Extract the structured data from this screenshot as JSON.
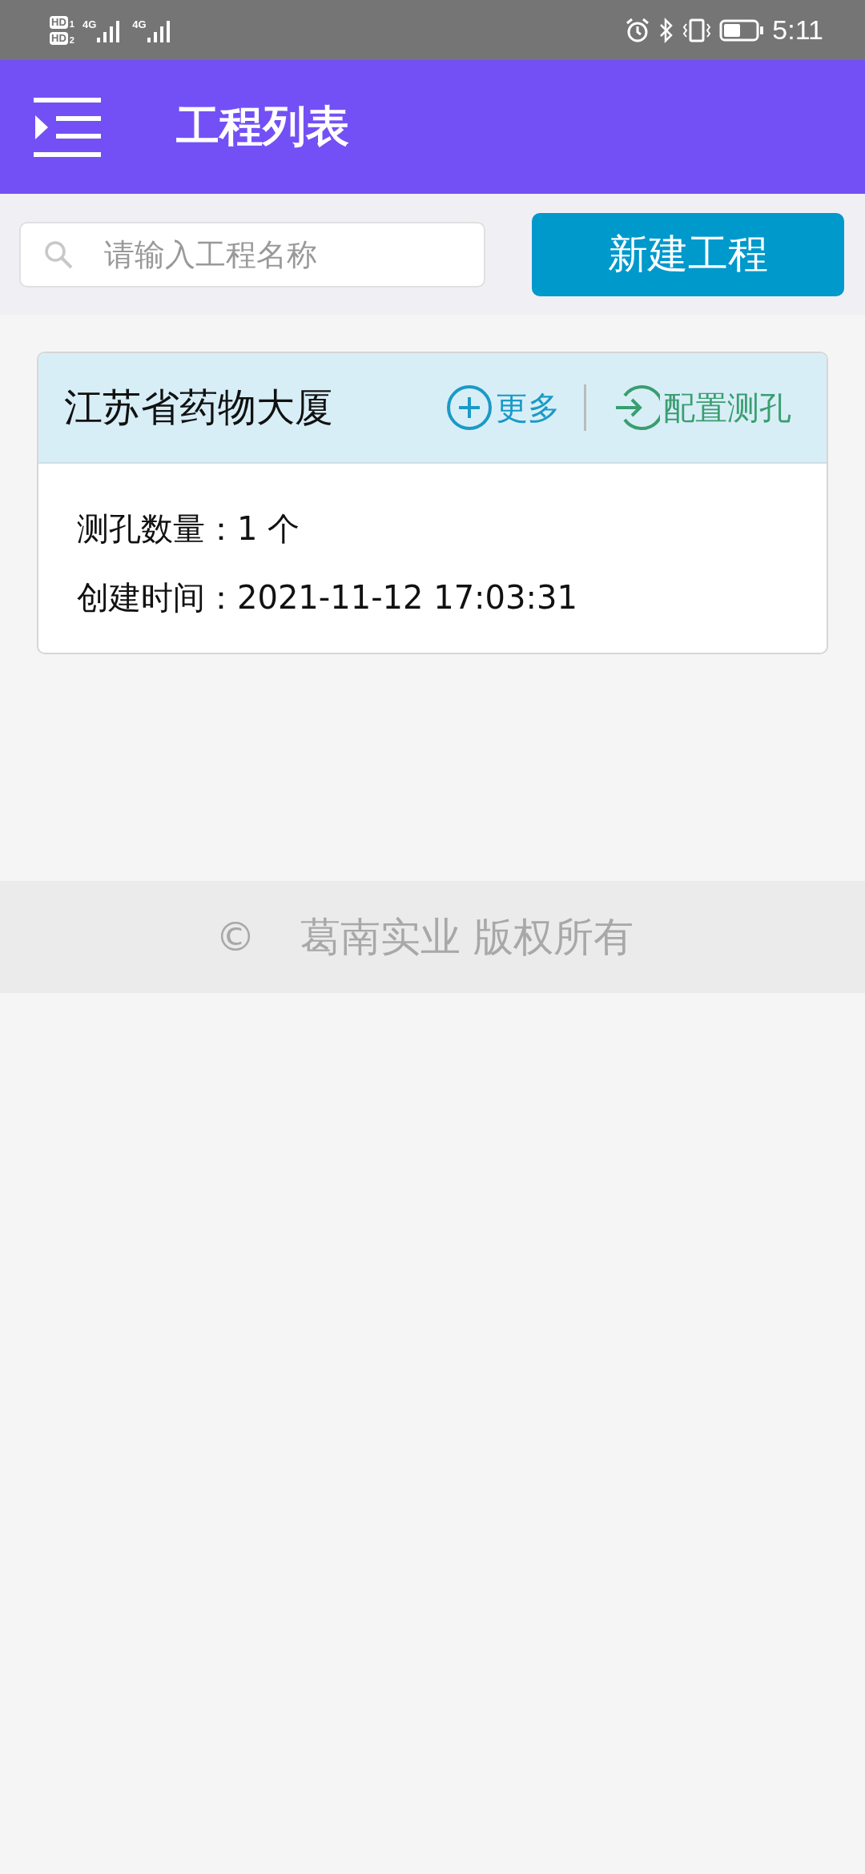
{
  "status_bar": {
    "sim_badges": [
      {
        "label": "HD",
        "index": "1"
      },
      {
        "label": "HD",
        "index": "2"
      }
    ],
    "networks": [
      "4G",
      "4G"
    ],
    "time": "5:11"
  },
  "app_bar": {
    "title": "工程列表"
  },
  "toolbar": {
    "search": {
      "placeholder": "请输入工程名称"
    },
    "new_button": "新建工程"
  },
  "projects": [
    {
      "name": "江苏省药物大厦",
      "more": "更多",
      "configure": "配置测孔",
      "details": [
        {
          "label": "测孔数量：",
          "value": "1 个"
        },
        {
          "label": "创建时间：",
          "value": "2021-11-12 17:03:31"
        }
      ]
    }
  ],
  "footer": {
    "symbol": "©",
    "text": "葛南实业 版权所有"
  }
}
